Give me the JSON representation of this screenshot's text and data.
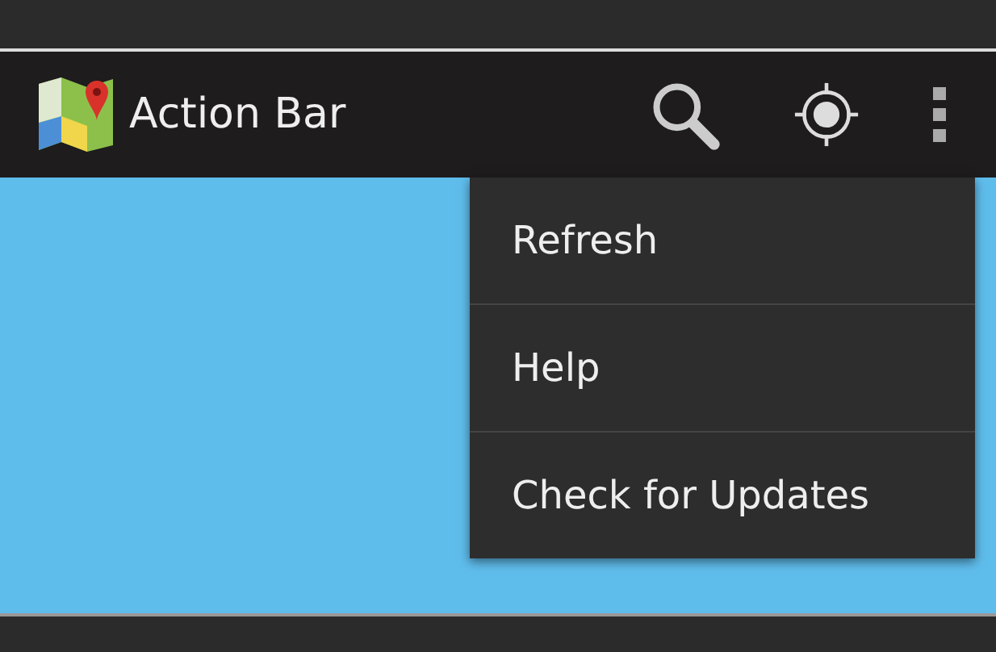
{
  "action_bar": {
    "title": "Action Bar"
  },
  "overflow_menu": {
    "items": [
      {
        "label": "Refresh"
      },
      {
        "label": "Help"
      },
      {
        "label": "Check for Updates"
      }
    ]
  }
}
